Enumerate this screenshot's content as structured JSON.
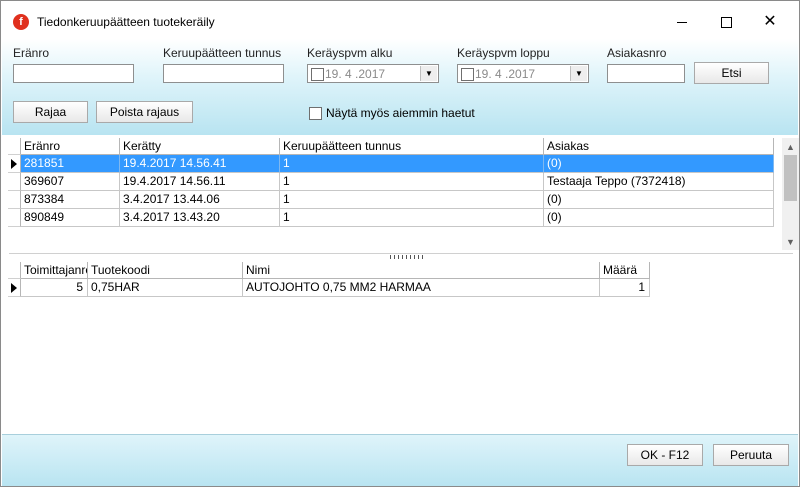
{
  "window": {
    "title": "Tiedonkeruupäätteen tuotekeräily",
    "app_icon": "f-logo-icon"
  },
  "filters": {
    "eranro_label": "Eränro",
    "eranro_value": "",
    "keruu_label": "Keruupäätteen tunnus",
    "keruu_value": "",
    "alku_label": "Keräyspvm alku",
    "alku_value": "19. 4 .2017",
    "loppu_label": "Keräyspvm loppu",
    "loppu_value": "19. 4 .2017",
    "asiakas_label": "Asiakasnro",
    "asiakas_value": "",
    "etsi_button": "Etsi",
    "rajaa_button": "Rajaa",
    "poista_button": "Poista rajaus",
    "nayta_checkbox": "Näytä myös aiemmin haetut"
  },
  "top_grid": {
    "headers": [
      "Eränro",
      "Kerätty",
      "Keruupäätteen tunnus",
      "Asiakas"
    ],
    "rows": [
      [
        "281851",
        "19.4.2017 14.56.41",
        "1",
        " (0)"
      ],
      [
        "369607",
        "19.4.2017 14.56.11",
        "1",
        "Testaaja Teppo (7372418)"
      ],
      [
        "873384",
        "3.4.2017 13.44.06",
        "1",
        " (0)"
      ],
      [
        "890849",
        "3.4.2017 13.43.20",
        "1",
        " (0)"
      ]
    ],
    "selected_row": 0
  },
  "bottom_grid": {
    "headers": [
      "Toimittajanro",
      "Tuotekoodi",
      "Nimi",
      "Määrä"
    ],
    "rows": [
      [
        "5",
        "0,75HAR",
        "AUTOJOHTO 0,75 MM2 HARMAA",
        "1"
      ]
    ]
  },
  "footer": {
    "ok_button": "OK - F12",
    "peruuta_button": "Peruuta"
  },
  "colors": {
    "selection": "#3399ff",
    "panel_gradient_top": "#ffffff",
    "panel_gradient_bottom": "#b8e4f1"
  }
}
